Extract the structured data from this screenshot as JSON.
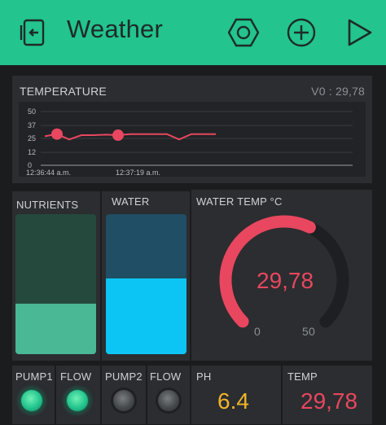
{
  "app": {
    "title": "Weather",
    "accent": "#23c48e"
  },
  "toolbar": {
    "back_icon": "back-icon",
    "settings_icon": "hexagon-settings-icon",
    "add_icon": "plus-icon",
    "play_icon": "play-icon"
  },
  "temperature_chart": {
    "label": "TEMPERATURE",
    "current": "V0 : 29,78",
    "color": "#e8475f",
    "chart_data": {
      "type": "line",
      "title": "TEMPERATURE",
      "y_ticks": [
        "50",
        "37",
        "25",
        "12",
        "0"
      ],
      "ylim": [
        0,
        50
      ],
      "x_ticks": [
        "12:36:44 a.m.",
        "12:37:19 a.m."
      ],
      "series": [
        {
          "name": "V0",
          "values": [
            27,
            29,
            24,
            28,
            28,
            28.5,
            28,
            29,
            29,
            29,
            29,
            24,
            29,
            29,
            29
          ]
        }
      ],
      "highlight_points": [
        1,
        6
      ]
    }
  },
  "nutrients": {
    "label": "NUTRIENTS",
    "level": 0.36,
    "color_fill": "#4ab795",
    "color_bg": "#25493c"
  },
  "water": {
    "label": "WATER",
    "level": 0.54,
    "color_fill": "#0dc5f5",
    "color_bg": "#204e64"
  },
  "water_temp": {
    "label": "WATER TEMP  °C",
    "value": "29,78",
    "min": "0",
    "max": "50",
    "fraction": 0.5956,
    "color": "#e8475f"
  },
  "pump1": {
    "label": "PUMP1",
    "on": true
  },
  "flow1": {
    "label": "FLOW",
    "on": true
  },
  "pump2": {
    "label": "PUMP2",
    "on": false
  },
  "flow2": {
    "label": "FLOW",
    "on": false
  },
  "ph": {
    "label": "PH",
    "value": "6.4",
    "color": "#f0b429"
  },
  "temp": {
    "label": "TEMP",
    "value": "29,78",
    "color": "#e8475f"
  }
}
